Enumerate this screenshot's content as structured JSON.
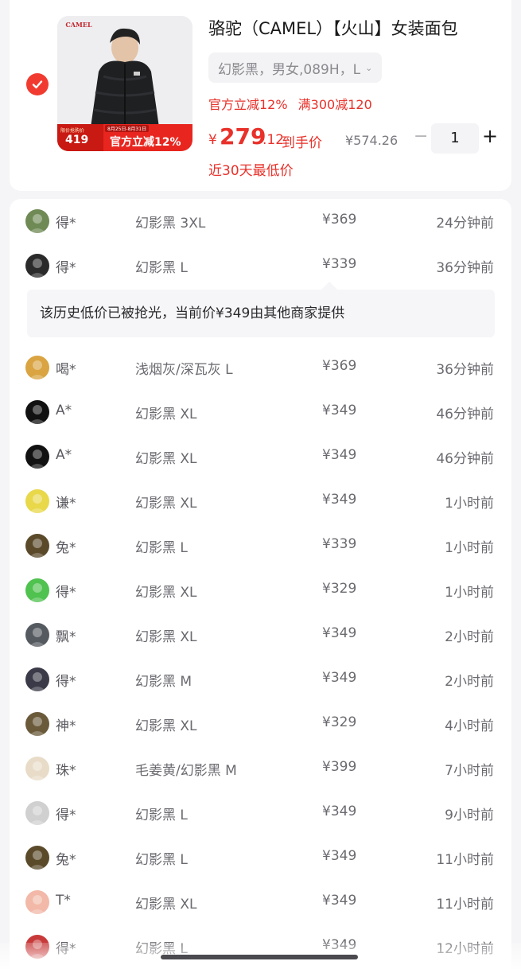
{
  "product": {
    "brand_logo_text": "CAMEL",
    "title": "骆驼（CAMEL）【火山】女装面包",
    "sku": "幻影黑，男女,089H，L",
    "discounts": [
      "官方立减12%",
      "满300减120"
    ],
    "price_currency": "¥",
    "price_integer": "279",
    "price_decimal": ".12",
    "price_tag": "到手价",
    "original_price": "¥574.26",
    "quantity": "1",
    "lowest_note": "近30天最低价",
    "thumb_promo": {
      "small_label": "限价抢购价",
      "number": "419",
      "date_range": "8月25日-8月31日",
      "text": "官方立减12%"
    }
  },
  "notice": "该历史低价已被抢光，当前价¥349由其他商家提供",
  "records": [
    {
      "user": "得*",
      "spec": "幻影黑 3XL",
      "price": "¥369",
      "time": "24分钟前",
      "avatar": "#6f8a55"
    },
    {
      "user": "得*",
      "spec": "幻影黑 L",
      "price": "¥339",
      "time": "36分钟前",
      "avatar": "#2a2a2a"
    },
    {
      "user": "喝*",
      "spec": "浅烟灰/深瓦灰 L",
      "price": "¥369",
      "time": "36分钟前",
      "avatar": "#d9a441"
    },
    {
      "user": "A*",
      "spec": "幻影黑 XL",
      "price": "¥349",
      "time": "46分钟前",
      "avatar": "#111111"
    },
    {
      "user": "A*",
      "spec": "幻影黑 XL",
      "price": "¥349",
      "time": "46分钟前",
      "avatar": "#111111"
    },
    {
      "user": "谦*",
      "spec": "幻影黑 XL",
      "price": "¥349",
      "time": "1小时前",
      "avatar": "#e8d84a"
    },
    {
      "user": "兔*",
      "spec": "幻影黑 L",
      "price": "¥339",
      "time": "1小时前",
      "avatar": "#5b4a2a"
    },
    {
      "user": "得*",
      "spec": "幻影黑 XL",
      "price": "¥329",
      "time": "1小时前",
      "avatar": "#4fc24f"
    },
    {
      "user": "飘*",
      "spec": "幻影黑 XL",
      "price": "¥349",
      "time": "2小时前",
      "avatar": "#555a60"
    },
    {
      "user": "得*",
      "spec": "幻影黑 M",
      "price": "¥349",
      "time": "2小时前",
      "avatar": "#3a3a48"
    },
    {
      "user": "神*",
      "spec": "幻影黑 XL",
      "price": "¥329",
      "time": "4小时前",
      "avatar": "#6a5a3a"
    },
    {
      "user": "珠*",
      "spec": "毛姜黄/幻影黑 M",
      "price": "¥399",
      "time": "7小时前",
      "avatar": "#e8dcc8"
    },
    {
      "user": "得*",
      "spec": "幻影黑 L",
      "price": "¥349",
      "time": "9小时前",
      "avatar": "#d0d0d0"
    },
    {
      "user": "兔*",
      "spec": "幻影黑 L",
      "price": "¥349",
      "time": "11小时前",
      "avatar": "#5b4a2a"
    },
    {
      "user": "T*",
      "spec": "幻影黑 XL",
      "price": "¥349",
      "time": "11小时前",
      "avatar": "#f2b8a8"
    },
    {
      "user": "得*",
      "spec": "幻影黑 L",
      "price": "¥349",
      "time": "12小时前",
      "avatar": "#c83a3a"
    }
  ]
}
